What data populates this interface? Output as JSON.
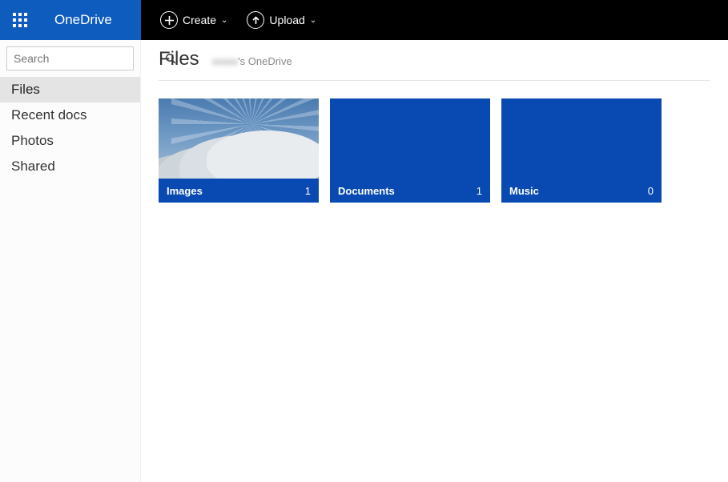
{
  "header": {
    "brand": "OneDrive",
    "actions": {
      "create": "Create",
      "upload": "Upload"
    }
  },
  "sidebar": {
    "search_placeholder": "Search",
    "items": [
      {
        "label": "Files",
        "active": true
      },
      {
        "label": "Recent docs",
        "active": false
      },
      {
        "label": "Photos",
        "active": false
      },
      {
        "label": "Shared",
        "active": false
      }
    ]
  },
  "breadcrumb": {
    "title": "Files",
    "subtitle_suffix": "'s OneDrive"
  },
  "tiles": [
    {
      "name": "Images",
      "count": 1,
      "preview": "sky"
    },
    {
      "name": "Documents",
      "count": 1,
      "preview": "solid"
    },
    {
      "name": "Music",
      "count": 0,
      "preview": "solid"
    }
  ],
  "colors": {
    "brand_blue": "#0f5cbf",
    "tile_blue": "#094ab2"
  }
}
